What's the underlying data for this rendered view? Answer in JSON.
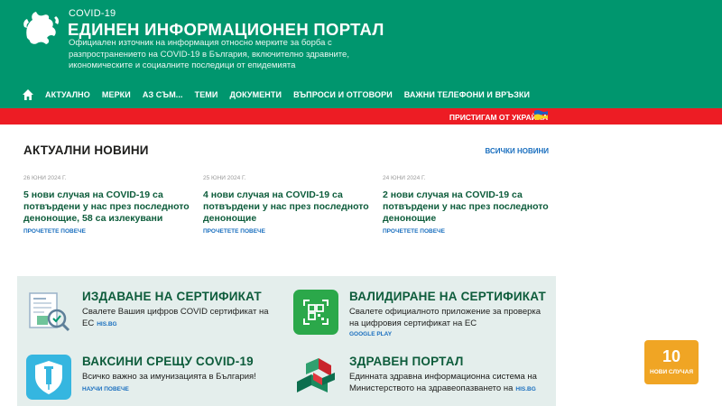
{
  "header": {
    "pre_title": "COVID-19",
    "title": "ЕДИНЕН ИНФОРМАЦИОНЕН ПОРТАЛ",
    "subtitle": "Официален източник на информация относно мерките за борба с разпространението на COVID-19 в България, включително здравните, икономическите и социалните последици от епидемията"
  },
  "nav": {
    "items": [
      "АКТУАЛНО",
      "МЕРКИ",
      "АЗ СЪМ...",
      "ТЕМИ",
      "ДОКУМЕНТИ",
      "ВЪПРОСИ И ОТГОВОРИ",
      "ВАЖНИ ТЕЛЕФОНИ И ВРЪЗКИ"
    ]
  },
  "banner": {
    "text": "ПРИСТИГАМ ОТ УКРАЙНА"
  },
  "news": {
    "heading": "АКТУАЛНИ НОВИНИ",
    "all_link": "ВСИЧКИ НОВИНИ",
    "articles": [
      {
        "date": "26 ЮНИ 2024 Г.",
        "title": "5 нови случая на COVID-19 са потвърдени у нас през последното денонощие, 58 са излекувани",
        "more": "ПРОЧЕТЕТЕ ПОВЕЧЕ"
      },
      {
        "date": "25 ЮНИ 2024 Г.",
        "title": "4 нови случая на COVID-19 са потвърдени у нас през последното денонощие",
        "more": "ПРОЧЕТЕТЕ ПОВЕЧЕ"
      },
      {
        "date": "24 ЮНИ 2024 Г.",
        "title": "2 нови случая на COVID-19 са потвърдени у нас през последното денонощие",
        "more": "ПРОЧЕТЕТЕ ПОВЕЧЕ"
      }
    ]
  },
  "cards": {
    "certificate": {
      "title": "ИЗДАВАНЕ НА СЕРТИФИКАТ",
      "text": "Свалете Вашия цифров COVID сертификат на ЕС",
      "link": "HIS.BG"
    },
    "validate": {
      "title": "ВАЛИДИРАНЕ НА СЕРТИФИКАТ",
      "text": "Свалете официалното приложение за проверка на цифровия сертификат на ЕС",
      "link": "GOOGLE PLAY"
    },
    "vaccines": {
      "title": "ВАКСИНИ СРЕЩУ COVID-19",
      "text": "Всичко важно за имунизацията в България!",
      "link": "НАУЧИ ПОВЕЧЕ"
    },
    "portal": {
      "title": "ЗДРАВЕН ПОРТАЛ",
      "text": "Единната здравна информационна система на Министерството на здравеопазването на",
      "link": "HIS.BG"
    }
  },
  "cases": {
    "count": "10",
    "label": "НОВИ СЛУЧАЯ"
  },
  "colors": {
    "brand_green": "#00966e",
    "dark_green": "#0d5c3b",
    "banner_red": "#ed1c24",
    "link_blue": "#1a6fbf",
    "cases_orange": "#f0a524"
  },
  "icons": [
    "crest-icon",
    "home-icon",
    "ukraine-flag-icon",
    "certificate-icon",
    "qr-phone-icon",
    "vaccine-shield-icon",
    "health-portal-icon"
  ]
}
